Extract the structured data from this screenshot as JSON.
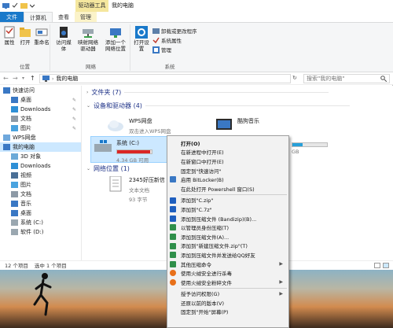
{
  "window": {
    "title": "我的电脑",
    "context_tab": "驱动器工具"
  },
  "ribbon_tabs": [
    "文件",
    "计算机",
    "查看",
    "管理"
  ],
  "ribbon": {
    "location_group": {
      "label": "位置",
      "buttons": [
        "属性",
        "打开",
        "重命名"
      ]
    },
    "network_group": {
      "label": "网络",
      "buttons": [
        "访问媒体",
        "映射网络驱动器",
        "添加一个网络位置"
      ]
    },
    "system_group": {
      "label": "系统",
      "open_settings": "打开设置",
      "items": [
        "卸载或更改程序",
        "系统属性",
        "管理"
      ]
    }
  },
  "address_bar": {
    "back": "←",
    "forward": "→",
    "up": "↑",
    "path": "我的电脑",
    "refresh": "↻",
    "search_placeholder": "搜索\"我的电脑\""
  },
  "sidebar": {
    "items": [
      {
        "label": "快速访问",
        "icon": "star-icon",
        "pinned": false
      },
      {
        "label": "桌面",
        "icon": "desktop-icon",
        "pinned": true
      },
      {
        "label": "Downloads",
        "icon": "download-icon",
        "pinned": true
      },
      {
        "label": "文档",
        "icon": "document-icon",
        "pinned": true
      },
      {
        "label": "图片",
        "icon": "picture-icon",
        "pinned": true
      },
      {
        "label": "WPS网盘",
        "icon": "cloud-icon",
        "pinned": false
      },
      {
        "label": "我的电脑",
        "icon": "computer-icon",
        "pinned": false,
        "selected": true
      },
      {
        "label": "3D 对象",
        "icon": "cube-icon",
        "pinned": false
      },
      {
        "label": "Downloads",
        "icon": "download-icon",
        "pinned": false
      },
      {
        "label": "视频",
        "icon": "video-icon",
        "pinned": false
      },
      {
        "label": "图片",
        "icon": "picture-icon",
        "pinned": false
      },
      {
        "label": "文档",
        "icon": "document-icon",
        "pinned": false
      },
      {
        "label": "音乐",
        "icon": "music-icon",
        "pinned": false
      },
      {
        "label": "桌面",
        "icon": "desktop-icon",
        "pinned": false
      },
      {
        "label": "系统 (C:)",
        "icon": "drive-icon",
        "pinned": false
      },
      {
        "label": "软件 (D:)",
        "icon": "drive-icon",
        "pinned": false
      }
    ]
  },
  "main": {
    "folders_header": "文件夹 (7)",
    "devices_header": "设备和驱动器 (4)",
    "network_header": "网络位置 (1)",
    "devices": [
      {
        "name": "WPS网盘",
        "sub": "双击进入WPS网盘"
      },
      {
        "name": "酷狗音乐",
        "sub": ""
      },
      {
        "name": "系统 (C:)",
        "free": "4.34 GB 可用",
        "used_fraction": 0.96
      }
    ],
    "drive_d_fragment": "GB",
    "network_item": {
      "name": "2345好压新信",
      "type": "文本文档",
      "size": "93 字节"
    }
  },
  "status_bar": {
    "count": "12 个项目",
    "selected": "选中 1 个项目"
  },
  "context_menu": {
    "items": [
      {
        "label": "打开(O)",
        "bold": true
      },
      {
        "label": "在新进程中打开(E)"
      },
      {
        "label": "在新窗口中打开(E)"
      },
      {
        "label": "固定到\"快速访问\""
      },
      {
        "label": "启用 BitLocker(B)",
        "icon": "shield-icon"
      },
      {
        "label": "在此处打开 Powershell 窗口(S)"
      },
      {
        "sep": true
      },
      {
        "label": "添加到\"C.zip\"",
        "icon": "bandizip-icon"
      },
      {
        "label": "添加到\"C.7z\"",
        "icon": "bandizip-icon"
      },
      {
        "label": "添加到压缩文件 (Bandizip)(B)...",
        "icon": "bandizip-icon"
      },
      {
        "label": "以管理员身份压缩(T)",
        "icon": "haozip-icon"
      },
      {
        "label": "添加到压缩文件(A)...",
        "icon": "haozip-icon"
      },
      {
        "label": "添加到\"新建压缩文件.zip\"(T)",
        "icon": "haozip-icon"
      },
      {
        "label": "添加到压缩文件并发送给QQ好友",
        "icon": "haozip-icon"
      },
      {
        "label": "其他压缩命令",
        "icon": "haozip-icon",
        "submenu": true
      },
      {
        "label": "使用火绒安全进行杀毒",
        "icon": "huorong-icon"
      },
      {
        "label": "使用火绒安全粉碎文件",
        "icon": "huorong-icon",
        "submenu": true
      },
      {
        "sep": true
      },
      {
        "label": "授予访问权限(G)",
        "submenu": true
      },
      {
        "label": "还原以前的版本(V)"
      },
      {
        "label": "固定到\"开始\"屏幕(P)"
      }
    ]
  }
}
